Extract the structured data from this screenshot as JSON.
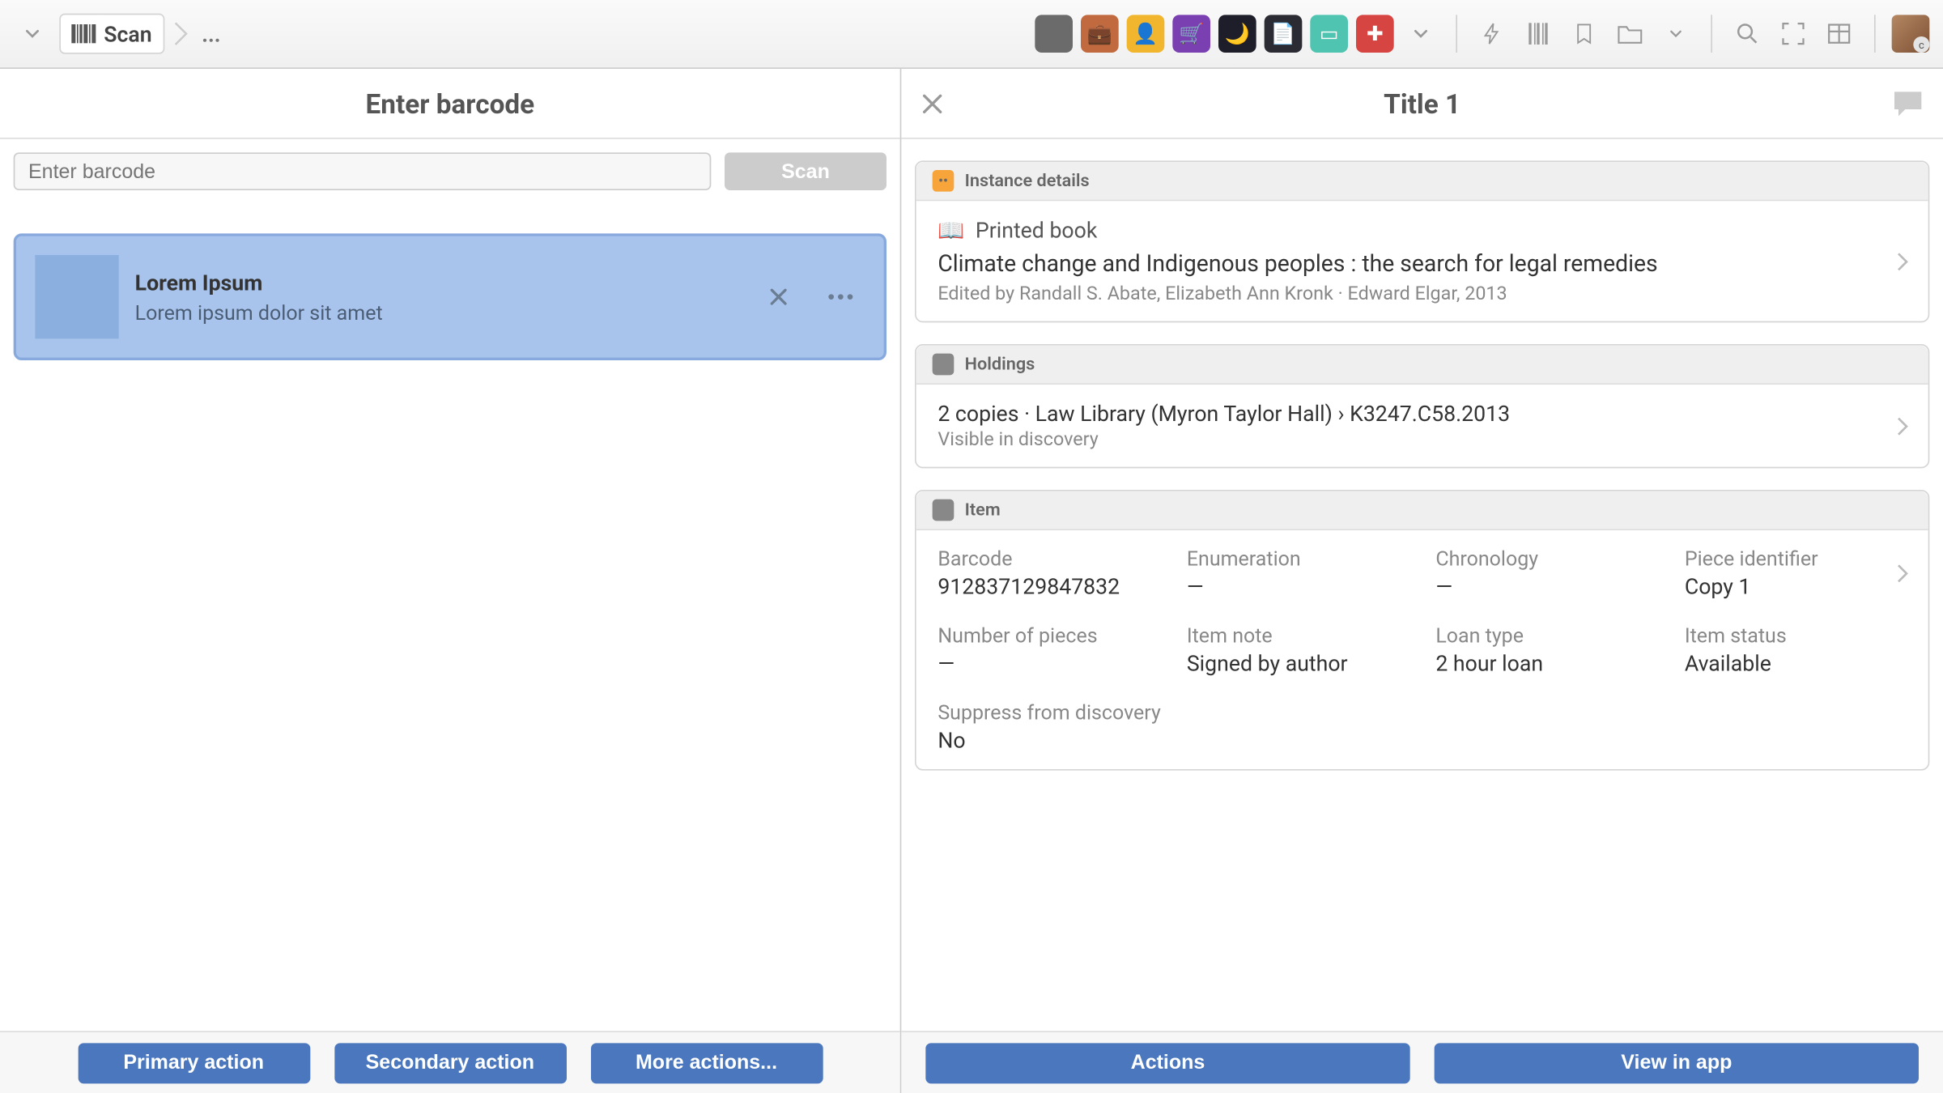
{
  "topbar": {
    "scan_label": "Scan",
    "ellipsis": "..."
  },
  "left": {
    "header": "Enter barcode",
    "input_placeholder": "Enter barcode",
    "scan_button": "Scan",
    "item": {
      "title": "Lorem Ipsum",
      "subtitle": "Lorem ipsum dolor sit amet"
    },
    "footer": {
      "primary": "Primary action",
      "secondary": "Secondary action",
      "more": "More actions..."
    }
  },
  "right": {
    "header": "Title 1",
    "instance": {
      "header": "Instance details",
      "type": "Printed book",
      "title": "Climate change and Indigenous peoples : the search for legal remedies",
      "meta": "Edited by Randall S. Abate, Elizabeth Ann Kronk · Edward Elgar, 2013"
    },
    "holdings": {
      "header": "Holdings",
      "line": "2 copies · Law Library (Myron Taylor Hall) › K3247.C58.2013",
      "sub": "Visible in discovery"
    },
    "item": {
      "header": "Item",
      "fields": {
        "barcode": {
          "label": "Barcode",
          "value": "912837129847832"
        },
        "enumeration": {
          "label": "Enumeration",
          "value": "—"
        },
        "chronology": {
          "label": "Chronology",
          "value": "—"
        },
        "piece_identifier": {
          "label": "Piece identifier",
          "value": "Copy 1"
        },
        "number_of_pieces": {
          "label": "Number of pieces",
          "value": "—"
        },
        "item_note": {
          "label": "Item note",
          "value": "Signed by author"
        },
        "loan_type": {
          "label": "Loan type",
          "value": "2 hour loan"
        },
        "item_status": {
          "label": "Item status",
          "value": "Available"
        },
        "suppress": {
          "label": "Suppress from discovery",
          "value": "No"
        }
      }
    },
    "footer": {
      "actions": "Actions",
      "view": "View in app"
    }
  },
  "app_icons": [
    {
      "bg": "#6b6b6b",
      "glyph": ""
    },
    {
      "bg": "#c26a3f",
      "glyph": "💼"
    },
    {
      "bg": "#f2b62e",
      "glyph": "👤"
    },
    {
      "bg": "#7a3fb0",
      "glyph": "🛒"
    },
    {
      "bg": "#1e1e2a",
      "glyph": "🌙"
    },
    {
      "bg": "#2b2b33",
      "glyph": "📄"
    },
    {
      "bg": "#4fc4b0",
      "glyph": "▭"
    },
    {
      "bg": "#d64541",
      "glyph": "✚"
    }
  ]
}
